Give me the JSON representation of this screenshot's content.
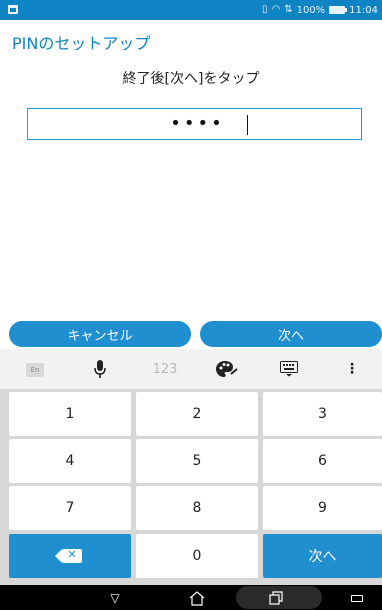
{
  "status_bar": {
    "battery": "100%",
    "time": "11:04",
    "icons": [
      "notification-icon",
      "vibrate-icon",
      "wifi-icon",
      "sync-icon",
      "battery-icon"
    ]
  },
  "header": {
    "title": "PINのセットアップ"
  },
  "instruction": "終了後[次へ]をタップ",
  "pin_field": {
    "masked_value": "••••"
  },
  "actions": {
    "cancel_label": "キャンセル",
    "next_label": "次へ"
  },
  "keyboard": {
    "toolbar": {
      "lang_label": "En",
      "num_label": "123",
      "icons": [
        "language-icon",
        "microphone-icon",
        "number-mode-icon",
        "theme-palette-icon",
        "keyboard-icon",
        "more-options-icon"
      ]
    },
    "keys": {
      "k1": "1",
      "k2": "2",
      "k3": "3",
      "k4": "4",
      "k5": "5",
      "k6": "6",
      "k7": "7",
      "k8": "8",
      "k9": "9",
      "k0": "0",
      "backspace_glyph": "✕",
      "next_label": "次へ"
    },
    "colors": {
      "accent": "#1f8fd0",
      "key_bg": "#ffffff",
      "board_bg": "#d7d7d7"
    }
  },
  "navbar": {
    "icons": [
      "back-icon",
      "home-icon",
      "recents-icon",
      "keyboard-switch-icon"
    ]
  },
  "colors": {
    "status_bar": "#0e84c4",
    "title": "#0e84c4"
  }
}
